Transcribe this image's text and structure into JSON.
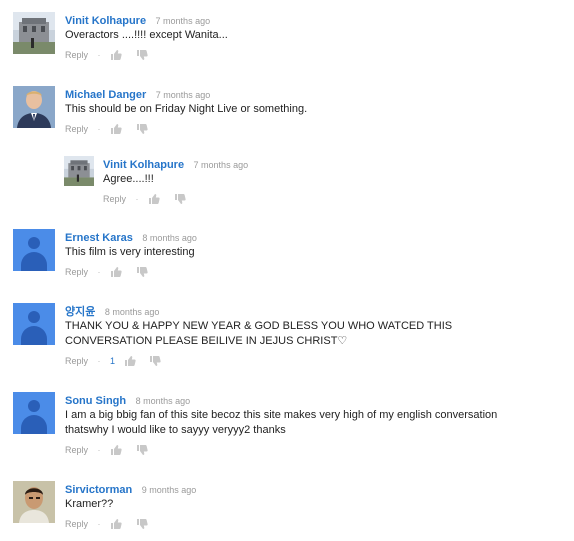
{
  "comments": [
    {
      "author": "Vinit Kolhapure",
      "time": "7 months ago",
      "text": "Overactors ....!!!! except Wanita...",
      "reply_label": "Reply",
      "likes": "",
      "avatar": "photo-building"
    },
    {
      "author": "Michael Danger",
      "time": "7 months ago",
      "text": "This should be on Friday Night Live or something.",
      "reply_label": "Reply",
      "likes": "",
      "avatar": "photo-man-suit"
    },
    {
      "author": "Vinit Kolhapure",
      "time": "7 months ago",
      "text": "Agree....!!!",
      "reply_label": "Reply",
      "likes": "",
      "avatar": "photo-building",
      "is_reply": true
    },
    {
      "author": "Ernest Karas",
      "time": "8 months ago",
      "text": "This film is very interesting",
      "reply_label": "Reply",
      "likes": "",
      "avatar": "default-user"
    },
    {
      "author": "양지윤",
      "time": "8 months ago",
      "text": "THANK YOU & HAPPY NEW YEAR & GOD BLESS YOU WHO WATCED THIS CONVERSATION PLEASE BEILIVE IN JEJUS CHRIST♡",
      "reply_label": "Reply",
      "likes": "1",
      "avatar": "default-user"
    },
    {
      "author": "Sonu Singh",
      "time": "8 months ago",
      "text": "I am a big bbig fan of this site becoz this site makes very high of my english conversation thatswhy I would like to sayyy veryyy2 thanks",
      "reply_label": "Reply",
      "likes": "",
      "avatar": "default-user"
    },
    {
      "author": "Sirvictorman",
      "time": "9 months ago",
      "text": "Kramer??",
      "reply_label": "Reply",
      "likes": "",
      "avatar": "photo-man-face"
    }
  ],
  "icons": {
    "thumb_up": "thumbs-up-icon",
    "thumb_down": "thumbs-down-icon"
  },
  "colors": {
    "author": "#2675c9",
    "muted": "#9a9a9a",
    "default_avatar": "#4b8ce8"
  }
}
